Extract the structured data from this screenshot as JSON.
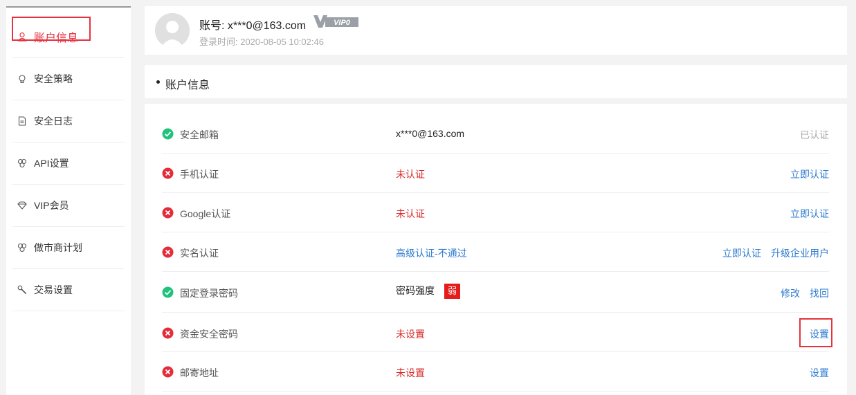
{
  "sidebar": {
    "items": [
      {
        "label": "账户信息",
        "icon": "user-icon",
        "active": true
      },
      {
        "label": "安全策略",
        "icon": "lightbulb-icon"
      },
      {
        "label": "安全日志",
        "icon": "document-icon"
      },
      {
        "label": "API设置",
        "icon": "api-icon"
      },
      {
        "label": "VIP会员",
        "icon": "diamond-icon"
      },
      {
        "label": "做市商计划",
        "icon": "market-maker-icon"
      },
      {
        "label": "交易设置",
        "icon": "wrench-icon"
      }
    ]
  },
  "header": {
    "account": "账号: x***0@163.com",
    "vip": "VIP0",
    "login_time": "登录时间: 2020-08-05 10:02:46"
  },
  "section": {
    "title": "账户信息"
  },
  "rows": [
    {
      "status": "ok",
      "label": "安全邮箱",
      "value": "x***0@163.com",
      "value_style": "dark",
      "actions": [
        {
          "label": "已认证",
          "style": "gray"
        }
      ]
    },
    {
      "status": "fail",
      "label": "手机认证",
      "value": "未认证",
      "value_style": "red",
      "actions": [
        {
          "label": "立即认证"
        }
      ]
    },
    {
      "status": "fail",
      "label": "Google认证",
      "value": "未认证",
      "value_style": "red",
      "actions": [
        {
          "label": "立即认证"
        }
      ]
    },
    {
      "status": "fail",
      "label": "实名认证",
      "value": "高级认证-不通过",
      "value_style": "blue",
      "actions": [
        {
          "label": "立即认证"
        },
        {
          "label": "升级企业用户"
        }
      ]
    },
    {
      "status": "ok",
      "label": "固定登录密码",
      "value": "密码强度",
      "badge": "弱",
      "value_style": "dark",
      "actions": [
        {
          "label": "修改"
        },
        {
          "label": "找回"
        }
      ]
    },
    {
      "status": "fail",
      "label": "资金安全密码",
      "value": "未设置",
      "value_style": "red",
      "actions": [
        {
          "label": "设置"
        }
      ]
    },
    {
      "status": "fail",
      "label": "邮寄地址",
      "value": "未设置",
      "value_style": "red",
      "actions": [
        {
          "label": "设置"
        }
      ]
    }
  ],
  "colors": {
    "accent": "#e5323e",
    "link": "#2d7bd0",
    "ok": "#1fc37a",
    "fail": "#e52b3a"
  }
}
